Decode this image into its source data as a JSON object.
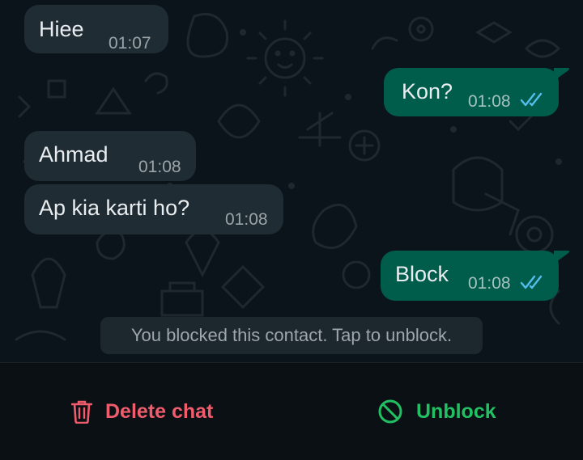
{
  "messages": [
    {
      "direction": "in",
      "text": "Hiee",
      "time": "01:07"
    },
    {
      "direction": "out",
      "text": "Kon?",
      "time": "01:08",
      "status": "read"
    },
    {
      "direction": "in",
      "text": "Ahmad",
      "time": "01:08"
    },
    {
      "direction": "in",
      "text": "Ap kia karti ho?",
      "time": "01:08"
    },
    {
      "direction": "out",
      "text": "Block",
      "time": "01:08",
      "status": "read"
    }
  ],
  "system_note": "You blocked this contact. Tap to unblock.",
  "actions": {
    "delete_chat": "Delete chat",
    "unblock": "Unblock"
  },
  "icons": {
    "delete": "trash-icon",
    "unblock": "block-circle-icon",
    "read_receipt": "double-check-icon"
  },
  "colors": {
    "background": "#0b141a",
    "incoming_bubble": "#1f2c34",
    "outgoing_bubble": "#005c4b",
    "read_tick": "#53bdeb",
    "danger": "#f15c6d",
    "accent": "#21c063"
  }
}
